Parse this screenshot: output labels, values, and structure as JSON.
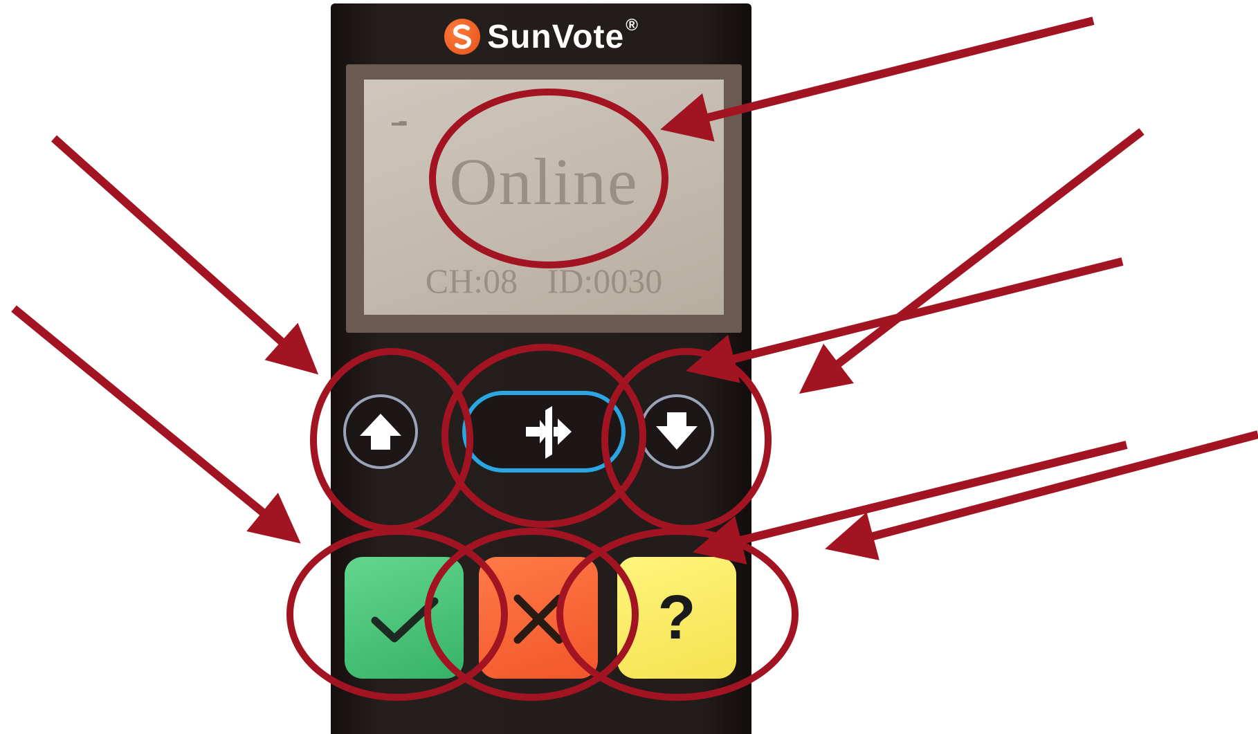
{
  "brand": {
    "name": "SunVote",
    "registered_mark": "®"
  },
  "screen": {
    "main_text": "Online",
    "status_text": "CH:08 ID:0030"
  },
  "nav_buttons": {
    "up_icon": "arrow-up-icon",
    "enter_icon": "enter-door-icon",
    "down_icon": "arrow-down-icon"
  },
  "answer_buttons": {
    "yes": {
      "icon": "checkmark-icon",
      "color": "#36b366"
    },
    "no": {
      "icon": "x-icon",
      "color": "#f2562a"
    },
    "unsure": {
      "label": "?",
      "color": "#f4e24f"
    }
  },
  "annotations": {
    "color": "#a31423",
    "circles": 7,
    "arrows": 8
  }
}
